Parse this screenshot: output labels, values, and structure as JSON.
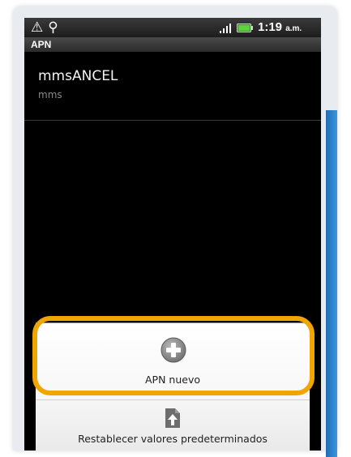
{
  "statusbar": {
    "alert_icon": "⚠",
    "usb_icon": "⚲",
    "time": "1:19",
    "ampm": "a.m."
  },
  "titlebar": {
    "title": "APN"
  },
  "apn_list": [
    {
      "name": "mmsANCEL",
      "type": "mms"
    }
  ],
  "menu": {
    "new_apn_label": "APN nuevo",
    "reset_label": "Restablecer valores predeterminados"
  },
  "colors": {
    "highlight": "#f0a500",
    "accent_strip": "#2a82cc"
  }
}
